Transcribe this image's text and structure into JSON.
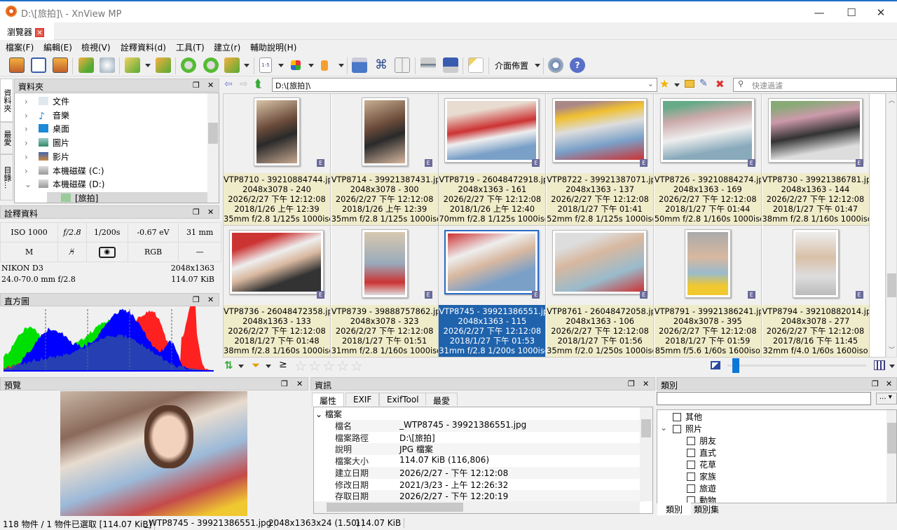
{
  "window": {
    "title": "D:\\[旅拍]\\ - XnView MP",
    "tab": "瀏覽器"
  },
  "menu": [
    "檔案(F)",
    "編輯(E)",
    "檢視(V)",
    "詮釋資料(d)",
    "工具(T)",
    "建立(r)",
    "輔助說明(H)"
  ],
  "toolbar": {
    "layout_label": "介面佈置",
    "view_mode_label": "1-5"
  },
  "side_tabs": [
    "資料夾",
    "最愛",
    "目錄..."
  ],
  "folders": {
    "title": "資料夾",
    "items": [
      {
        "label": "文件",
        "icon": "document-icon"
      },
      {
        "label": "音樂",
        "icon": "music-icon"
      },
      {
        "label": "桌面",
        "icon": "desktop-icon"
      },
      {
        "label": "圖片",
        "icon": "pictures-icon"
      },
      {
        "label": "影片",
        "icon": "video-icon"
      },
      {
        "label": "本機磁碟 (C:)",
        "icon": "drive-icon"
      },
      {
        "label": "本機磁碟 (D:)",
        "icon": "drive-icon"
      },
      {
        "label": "[旅拍]",
        "icon": "folder-icon"
      }
    ]
  },
  "metadata": {
    "title": "詮釋資料",
    "row1": [
      "ISO 1000",
      "f/2.8",
      "1/200s",
      "-0.67 eV",
      "31 mm"
    ],
    "row2": [
      "M",
      "flash-off",
      "metering",
      "RGB",
      "—"
    ],
    "camera": "NIKON D3",
    "lens": "24.0-70.0 mm f/2.8",
    "dimensions": "2048x1363",
    "size": "114.07 KiB"
  },
  "histogram": {
    "title": "直方圖"
  },
  "address": {
    "path": "D:\\[旅拍]\\",
    "filter_placeholder": "快速過濾"
  },
  "thumbnails": [
    {
      "name": "VTP8710 - 39210884744.jp",
      "dim": "2048x3078 - 240",
      "created": "2026/2/27 下午 12:12:08",
      "taken": "2018/1/26 上午 12:39",
      "exif": "35mm f/2.8 1/125s 1000iso",
      "portrait": true
    },
    {
      "name": "VTP8714 - 39921387431.jp",
      "dim": "2048x3078 - 300",
      "created": "2026/2/27 下午 12:12:08",
      "taken": "2018/1/26 上午 12:39",
      "exif": "35mm f/2.8 1/125s 1000iso",
      "portrait": true
    },
    {
      "name": "VTP8719 - 26048472918.jp",
      "dim": "2048x1363 - 161",
      "created": "2026/2/27 下午 12:12:08",
      "taken": "2018/1/26 上午 12:40",
      "exif": "70mm f/2.8 1/125s 1000iso",
      "portrait": false
    },
    {
      "name": "VTP8722 - 39921387071.jp",
      "dim": "2048x1363 - 137",
      "created": "2026/2/27 下午 12:12:08",
      "taken": "2018/1/27 下午 01:41",
      "exif": "52mm f/2.8 1/125s 1000iso",
      "portrait": false
    },
    {
      "name": "VTP8726 - 39210884274.jp",
      "dim": "2048x1363 - 169",
      "created": "2026/2/27 下午 12:12:08",
      "taken": "2018/1/27 下午 01:44",
      "exif": "50mm f/2.8 1/160s 1000iso",
      "portrait": false
    },
    {
      "name": "VTP8730 - 39921386781.jp",
      "dim": "2048x1363 - 144",
      "created": "2026/2/27 下午 12:12:08",
      "taken": "2018/1/27 下午 01:47",
      "exif": "38mm f/2.8 1/160s 1000iso",
      "portrait": false
    },
    {
      "name": "VTP8736 - 26048472358.jp",
      "dim": "2048x1363 - 133",
      "created": "2026/2/27 下午 12:12:08",
      "taken": "2018/1/27 下午 01:48",
      "exif": "38mm f/2.8 1/160s 1000iso",
      "portrait": false
    },
    {
      "name": "VTP8739 - 39888757862.jp",
      "dim": "2048x3078 - 323",
      "created": "2026/2/27 下午 12:12:08",
      "taken": "2018/1/27 下午 01:51",
      "exif": "31mm f/2.8 1/160s 1000iso",
      "portrait": true
    },
    {
      "name": "VTP8745 - 39921386551.jp",
      "dim": "2048x1363 - 115",
      "created": "2026/2/27 下午 12:12:08",
      "taken": "2018/1/27 下午 01:53",
      "exif": "31mm f/2.8 1/200s 1000iso",
      "portrait": false,
      "selected": true
    },
    {
      "name": "VTP8761 - 26048472058.jp",
      "dim": "2048x1363 - 106",
      "created": "2026/2/27 下午 12:12:08",
      "taken": "2018/1/27 下午 01:56",
      "exif": "35mm f/2.0 1/250s 1000iso",
      "portrait": false
    },
    {
      "name": "VTP8791 - 39921386241.jp",
      "dim": "2048x3078 - 395",
      "created": "2026/2/27 下午 12:12:08",
      "taken": "2018/1/27 下午 01:59",
      "exif": "85mm f/5.6 1/60s 1600iso",
      "portrait": true
    },
    {
      "name": "VTP8794 - 39210882014.jp",
      "dim": "2048x3078 - 277",
      "created": "2026/2/27 下午 12:12:08",
      "taken": "2017/8/16 下午 11:45",
      "exif": "32mm f/4.0 1/60s 1600iso",
      "portrait": true
    }
  ],
  "thumb_badge": "E",
  "rating_stars": 5,
  "preview": {
    "title": "預覽"
  },
  "info": {
    "title": "資訊",
    "tabs": [
      "屬性",
      "EXIF",
      "ExifTool",
      "最愛"
    ],
    "group": "檔案",
    "rows": [
      {
        "k": "檔名",
        "v": "_WTP8745 - 39921386551.jpg"
      },
      {
        "k": "檔案路徑",
        "v": "D:\\[旅拍]"
      },
      {
        "k": "說明",
        "v": "JPG 檔案"
      },
      {
        "k": "檔案大小",
        "v": "114.07 KiB (116,806)"
      },
      {
        "k": "建立日期",
        "v": "2026/2/27 - 下午 12:12:08"
      },
      {
        "k": "修改日期",
        "v": "2021/3/23 - 上午 12:26:32"
      },
      {
        "k": "存取日期",
        "v": "2026/2/27 - 下午 12:20:19"
      }
    ]
  },
  "categories": {
    "title": "類別",
    "more": "...",
    "items": [
      {
        "label": "其他",
        "level": 0
      },
      {
        "label": "照片",
        "level": 0,
        "expanded": true
      },
      {
        "label": "朋友",
        "level": 1
      },
      {
        "label": "直式",
        "level": 1
      },
      {
        "label": "花草",
        "level": 1
      },
      {
        "label": "家族",
        "level": 1
      },
      {
        "label": "旅遊",
        "level": 1
      },
      {
        "label": "動物",
        "level": 1
      }
    ],
    "tabs": [
      "類別",
      "類別集"
    ]
  },
  "status": {
    "count": "118 物件 / 1 物件已選取 [114.07 KiB]",
    "file": "_WTP8745 - 39921386551.jpg",
    "dims": "2048x1363x24 (1.50)",
    "size": "114.07 KiB"
  },
  "colors": {
    "accent": "#1f63ad",
    "caption_bg": "#efecca"
  }
}
